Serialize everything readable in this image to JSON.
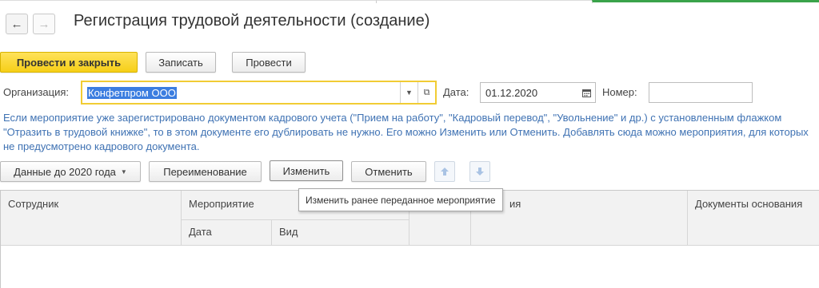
{
  "colors": {
    "accent_yellow": "#f6cf18",
    "info_text": "#3f72b3",
    "focus_border": "#f1cc34",
    "green_line": "#3aa34a"
  },
  "window": {
    "title": "Регистрация трудовой деятельности (создание)"
  },
  "nav": {
    "back_icon": "arrow-left-icon",
    "forward_icon": "arrow-right-icon"
  },
  "toolbar": {
    "post_and_close": "Провести и закрыть",
    "save": "Записать",
    "post": "Провести"
  },
  "form": {
    "organization_label": "Организация:",
    "organization_value": "Конфетпром ООО",
    "date_label": "Дата:",
    "date_value": "01.12.2020",
    "number_label": "Номер:",
    "number_value": ""
  },
  "info_text": "Если мероприятие уже зарегистрировано документом кадрового учета (\"Прием на работу\", \"Кадровый перевод\", \"Увольнение\" и др.) с установленным флажком \"Отразить в трудовой книжке\", то в этом документе его дублировать не нужно. Его можно Изменить или Отменить. Добавлять сюда можно мероприятия, для которых не предусмотрено кадрового документа.",
  "table_toolbar": {
    "data_before_2020": "Данные до 2020 года",
    "rename": "Переименование",
    "change": "Изменить",
    "cancel": "Отменить"
  },
  "table": {
    "columns": {
      "employee": "Сотрудник",
      "event": "Мероприятие",
      "date": "Дата",
      "kind": "Вид",
      "position_partial": "ия",
      "documents": "Документы основания"
    }
  },
  "tooltip": {
    "text": "Изменить ранее переданное мероприятие"
  }
}
